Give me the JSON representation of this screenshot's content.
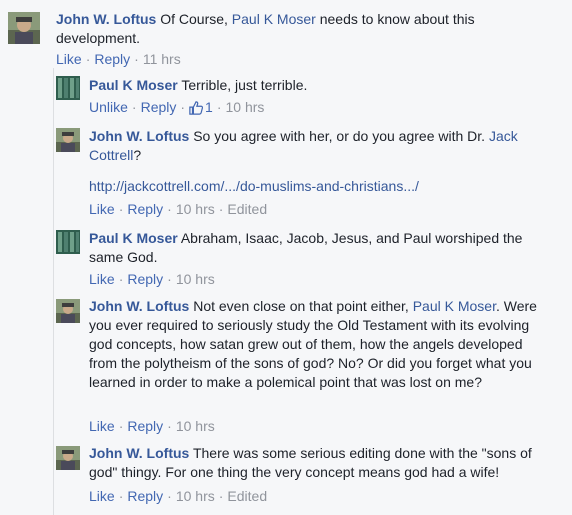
{
  "comments": [
    {
      "author": "John W. Loftus",
      "text_pre": " Of Course, ",
      "mention": "Paul K Moser",
      "text_post": " needs to know about this development.",
      "actions": {
        "like": "Like",
        "reply": "Reply",
        "time": "11 hrs"
      }
    },
    {
      "author": "Paul K Moser",
      "text": " Terrible, just terrible.",
      "actions": {
        "like": "Unlike",
        "reply": "Reply",
        "likes": "1",
        "time": "10 hrs"
      }
    },
    {
      "author": "John W. Loftus",
      "text_pre": " So you agree with her, or do you agree with Dr. ",
      "mention": "Jack Cottrell",
      "text_post": "?",
      "url": "http://jackcottrell.com/.../do-muslims-and-christians.../",
      "actions": {
        "like": "Like",
        "reply": "Reply",
        "time": "10 hrs",
        "edited": "Edited"
      }
    },
    {
      "author": "Paul K Moser",
      "text": " Abraham, Isaac, Jacob, Jesus, and Paul worshiped the same God.",
      "actions": {
        "like": "Like",
        "reply": "Reply",
        "time": "10 hrs"
      }
    },
    {
      "author": "John W. Loftus",
      "text_pre": " Not even close on that point either, ",
      "mention": "Paul K Moser",
      "text_post": ". Were you ever required to seriously study the Old Testament with its evolving god concepts, how satan grew out of them, how the angels developed from the polytheism of the sons of god? No? Or did you forget what you learned in order to make a polemical point that was lost on me?",
      "actions": {
        "like": "Like",
        "reply": "Reply",
        "time": "10 hrs"
      }
    },
    {
      "author": "John W. Loftus",
      "text": " There was some serious editing done with the \"sons of god\" thingy. For one thing the very concept means god had a wife!",
      "actions": {
        "like": "Like",
        "reply": "Reply",
        "time": "10 hrs",
        "edited": "Edited"
      }
    }
  ],
  "separator": "·"
}
